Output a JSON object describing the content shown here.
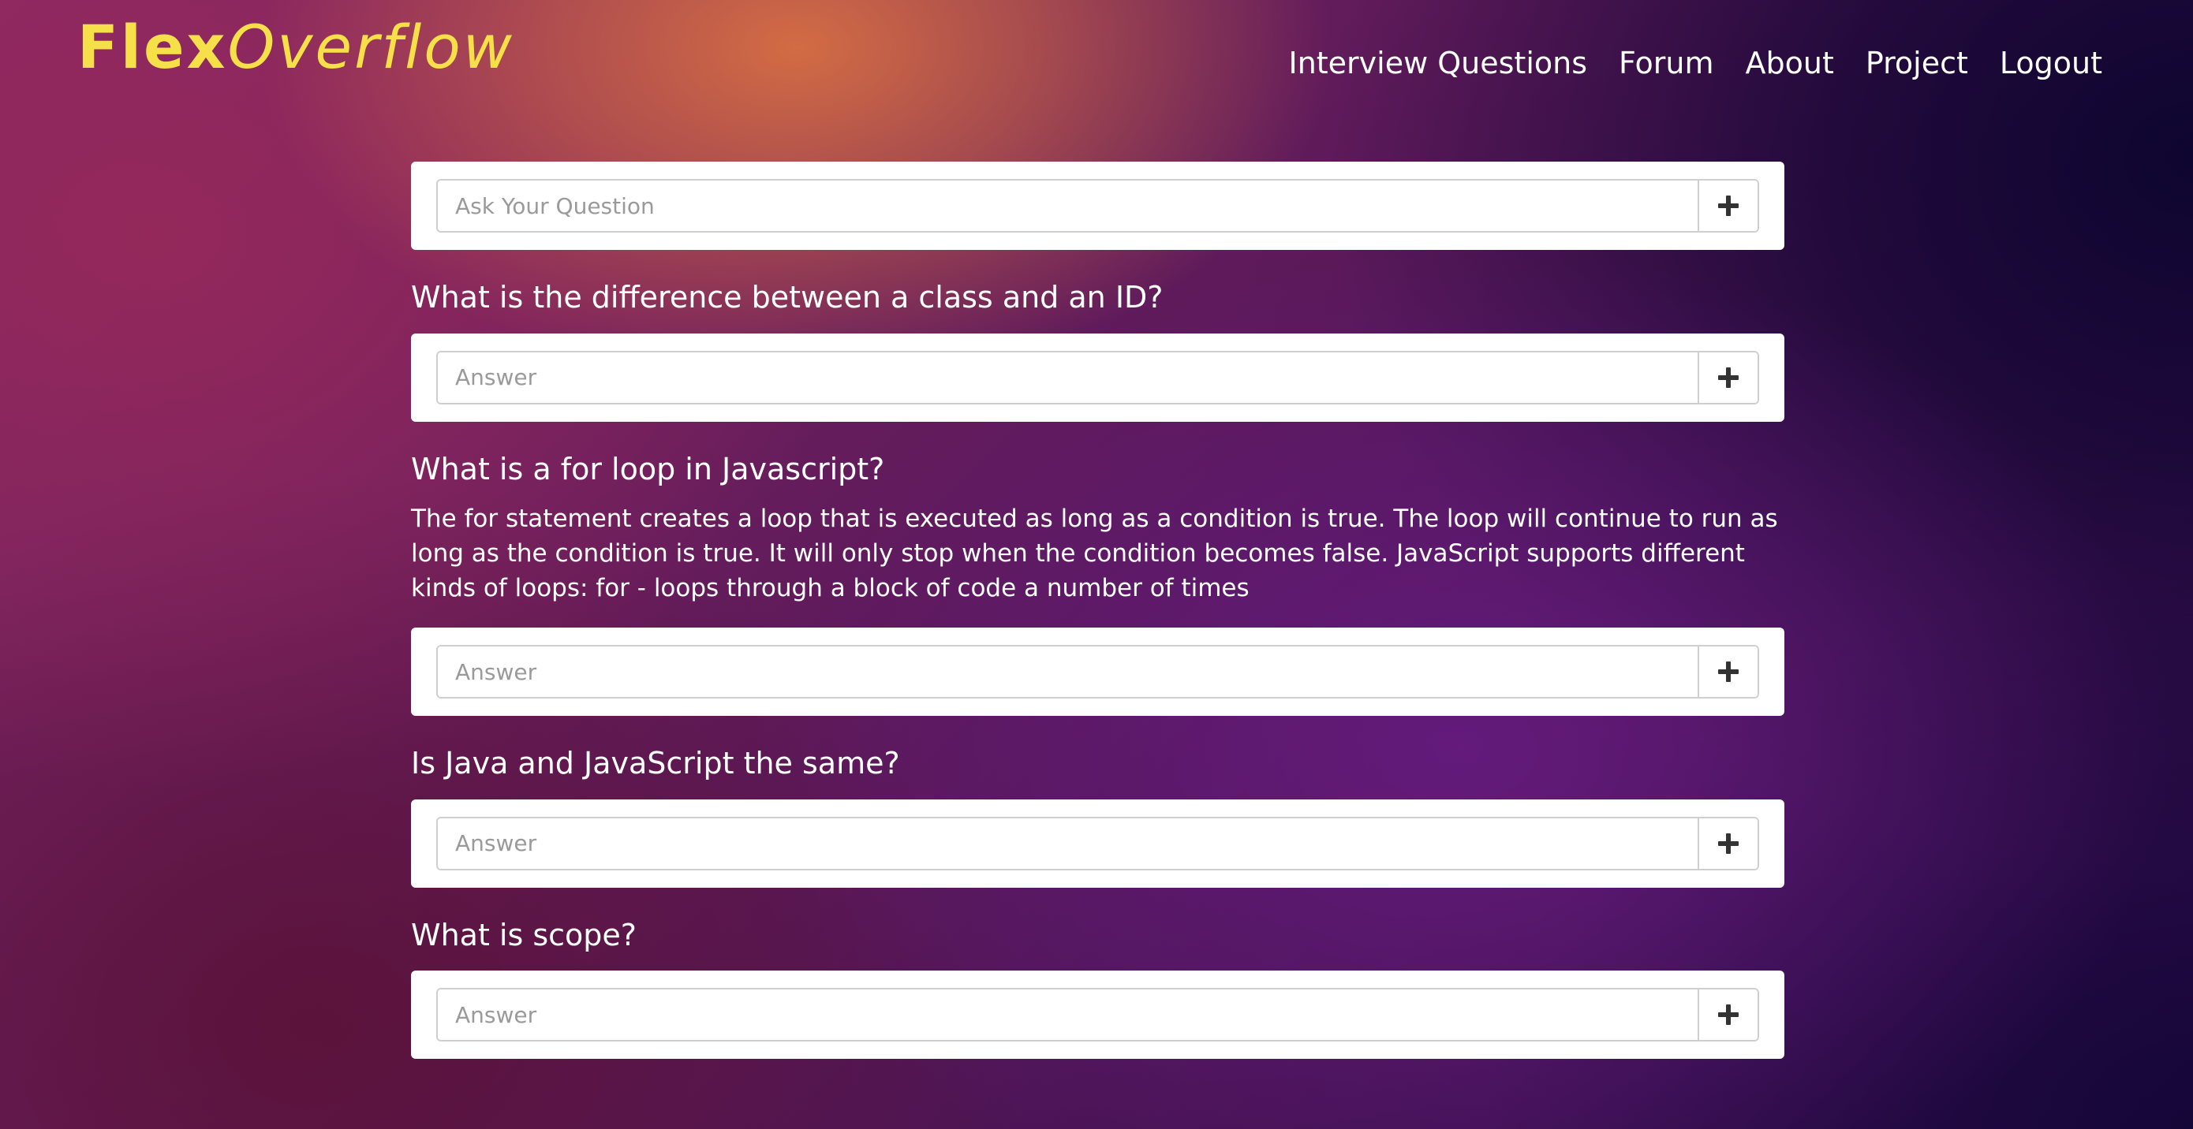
{
  "header": {
    "logo": {
      "part1": "Flex",
      "part2": "Overflow"
    },
    "nav": [
      {
        "label": "Interview Questions"
      },
      {
        "label": "Forum"
      },
      {
        "label": "About"
      },
      {
        "label": "Project"
      },
      {
        "label": "Logout"
      }
    ]
  },
  "ask": {
    "placeholder": "Ask Your Question",
    "value": ""
  },
  "questions": [
    {
      "title": "What is the difference between a class and an ID?",
      "answers": [],
      "answer_placeholder": "Answer"
    },
    {
      "title": "What is a for loop in Javascript?",
      "answers": [
        "The for statement creates a loop that is executed as long as a condition is true. The loop will continue to run as long as the condition is true. It will only stop when the condition becomes false. JavaScript supports different kinds of loops: for - loops through a block of code a number of times"
      ],
      "answer_placeholder": "Answer"
    },
    {
      "title": "Is Java and JavaScript the same?",
      "answers": [],
      "answer_placeholder": "Answer"
    },
    {
      "title": "What is scope?",
      "answers": [],
      "answer_placeholder": "Answer"
    }
  ],
  "icons": {
    "add": "plus-icon"
  },
  "colors": {
    "logo": "#f6e04a",
    "text": "#ffffff",
    "card": "#ffffff",
    "placeholder": "#9a9a9a",
    "icon": "#333333"
  }
}
